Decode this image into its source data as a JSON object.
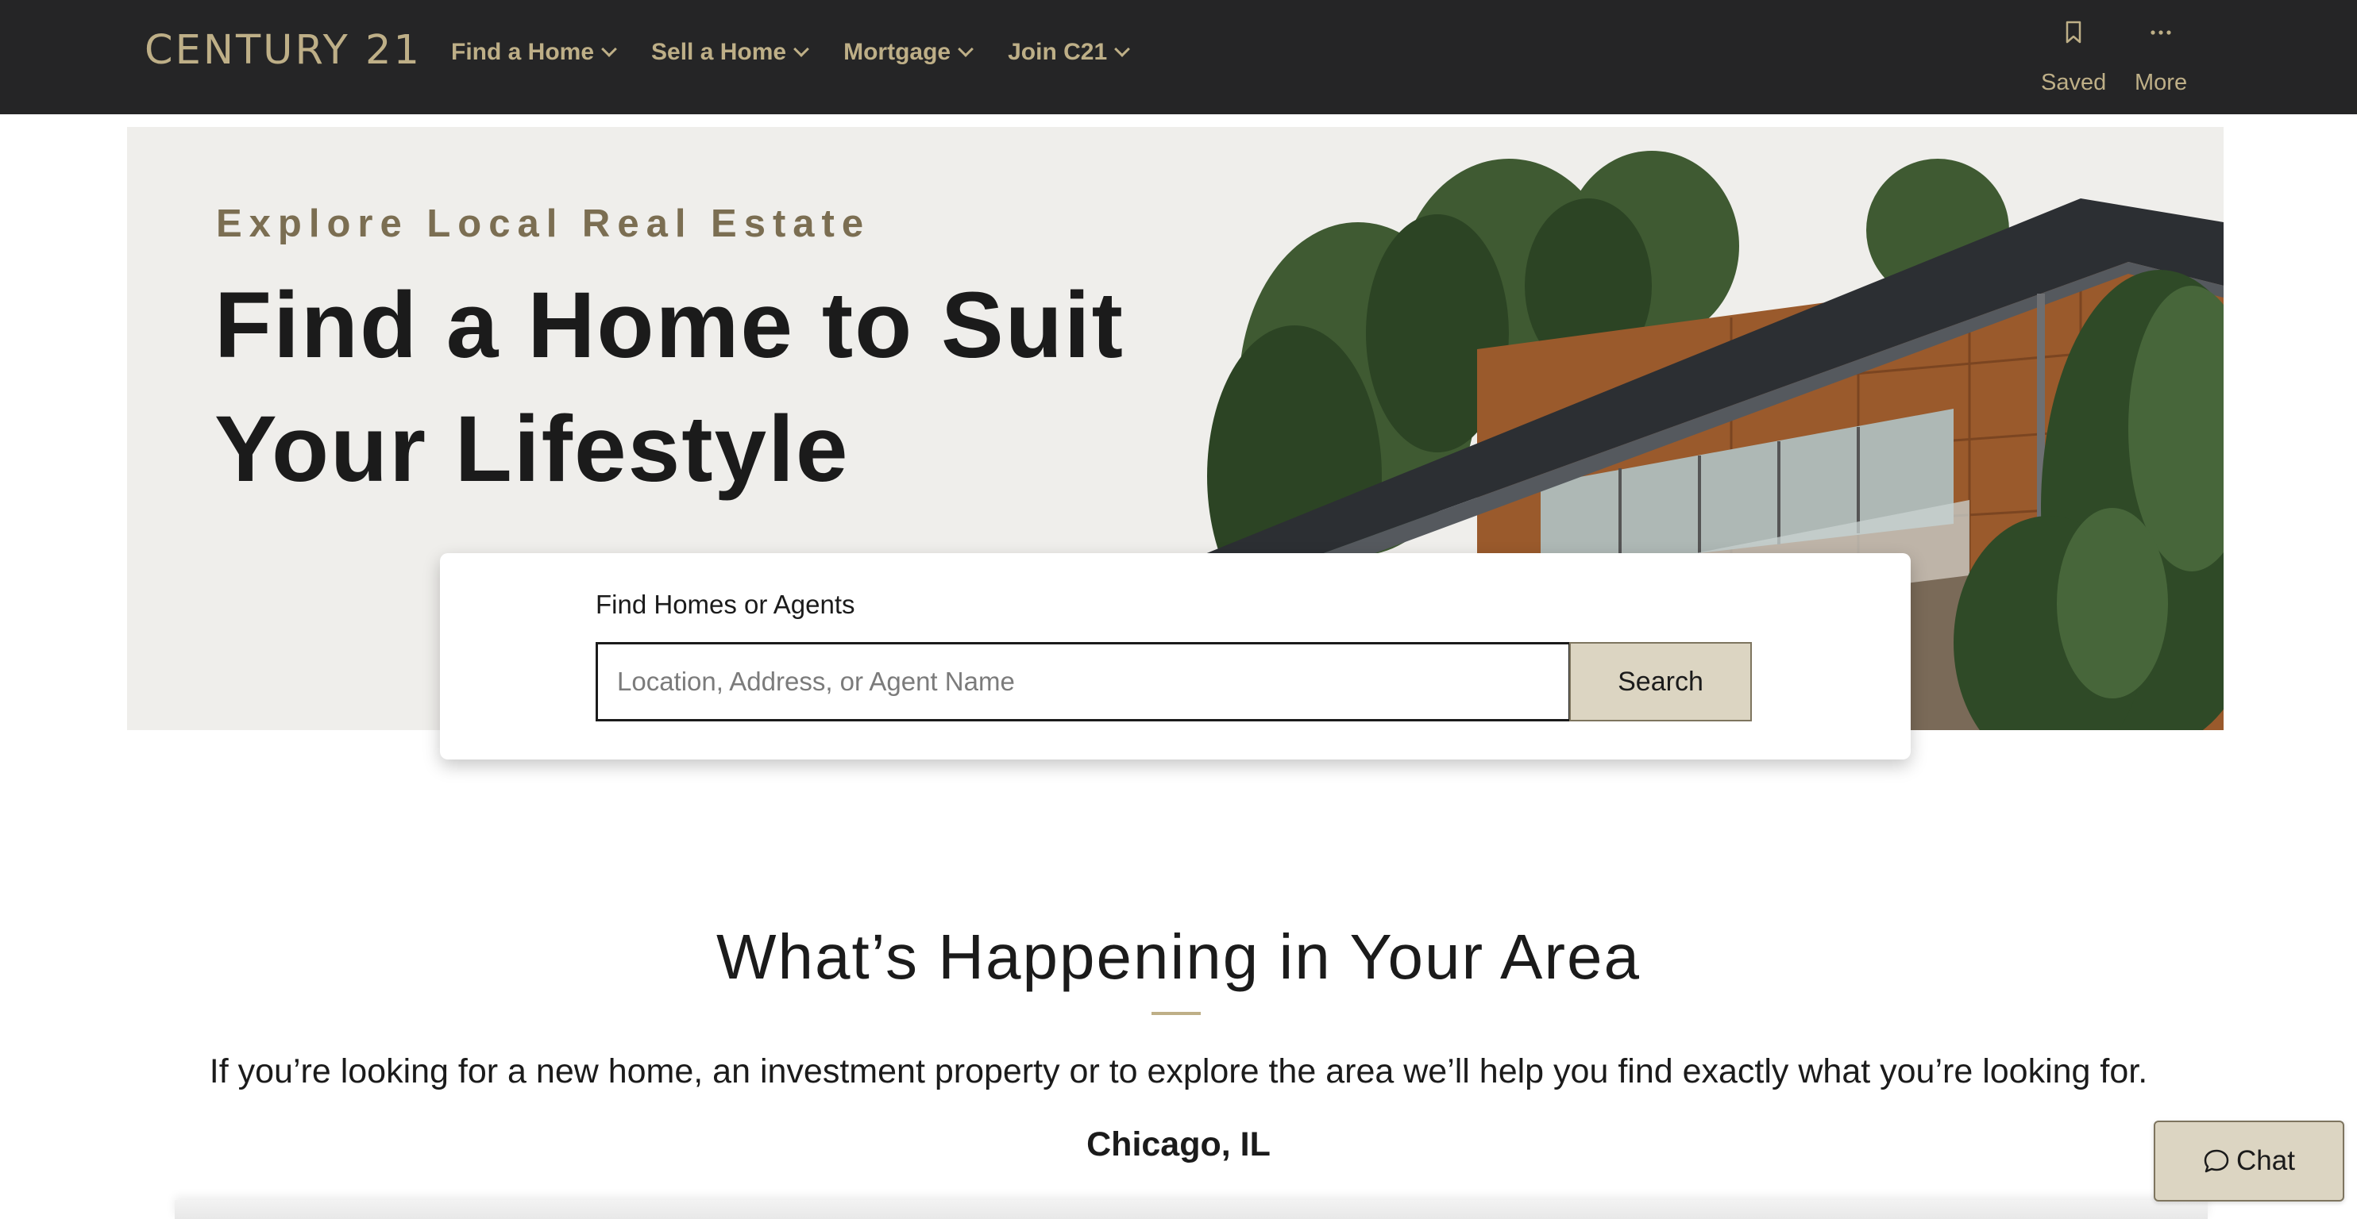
{
  "header": {
    "logo_text": "CENTURY 21",
    "nav": [
      {
        "label": "Find a Home"
      },
      {
        "label": "Sell a Home"
      },
      {
        "label": "Mortgage"
      },
      {
        "label": "Join C21"
      }
    ],
    "saved_label": "Saved",
    "more_label": "More",
    "icons": {
      "saved": "bookmark-icon",
      "more": "ellipsis-icon",
      "nav": "chevron-down-icon"
    },
    "colors": {
      "background": "#252526",
      "brand_gold": "#beaf87"
    }
  },
  "hero": {
    "eyebrow": "Explore Local Real Estate",
    "headline": "Find a Home to Suit Your Lifestyle",
    "image": "modern-house-with-trees"
  },
  "search": {
    "label": "Find Homes or Agents",
    "placeholder": "Location, Address, or Agent Name",
    "value": "",
    "button_label": "Search"
  },
  "area_section": {
    "title": "What’s Happening in Your Area",
    "description": "If you’re looking for a new home, an investment property or to explore the area we’ll help you find exactly what you’re looking for.",
    "location": "Chicago, IL"
  },
  "chat": {
    "label": "Chat",
    "icon": "chat-bubble-icon"
  }
}
